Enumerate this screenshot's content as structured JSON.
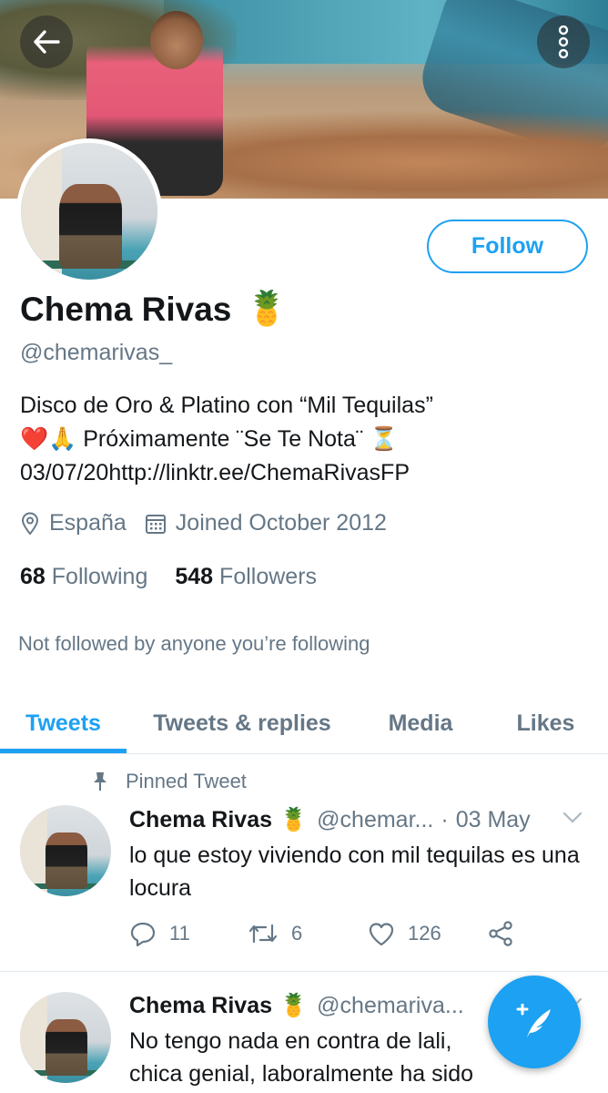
{
  "header": {
    "back_icon": "arrow-left-icon",
    "more_icon": "more-vertical-icon"
  },
  "profile": {
    "name": "Chema Rivas",
    "name_emoji": "🍍",
    "handle": "@chemarivas_",
    "follow_label": "Follow",
    "bio_line1": "Disco de Oro & Platino con “Mil Tequilas”",
    "bio_line2_text": " Próximamente ¨Se Te Nota¨ ",
    "bio_line2_emoji_heart": "❤️",
    "bio_line2_emoji_pray": "🙏",
    "bio_line2_emoji_hourglass": "⏳",
    "bio_line3": "03/07/20http://linktr.ee/ChemaRivasFP",
    "location": "España",
    "joined": "Joined October 2012",
    "following_count": "68",
    "following_label": "Following",
    "followers_count": "548",
    "followers_label": "Followers",
    "not_followed": "Not followed by anyone you’re following"
  },
  "tabs": [
    {
      "label": "Tweets",
      "active": true
    },
    {
      "label": "Tweets & replies",
      "active": false
    },
    {
      "label": "Media",
      "active": false
    },
    {
      "label": "Likes",
      "active": false
    }
  ],
  "tweets": [
    {
      "pinned_label": "Pinned Tweet",
      "name": "Chema Rivas",
      "emoji": "🍍",
      "handle": "@chemar...",
      "dot": "·",
      "date": "03 May",
      "text": "lo que estoy viviendo con mil tequilas es una locura",
      "replies": "11",
      "retweets": "6",
      "likes": "126"
    },
    {
      "name": "Chema Rivas",
      "emoji": "🍍",
      "handle": "@chemariva...",
      "text_line1": "No tengo nada en contra de lali,",
      "text_line2": "chica genial, laboralmente ha sido"
    }
  ],
  "colors": {
    "accent": "#1da1f2",
    "text": "#14171a",
    "secondary": "#657786"
  }
}
